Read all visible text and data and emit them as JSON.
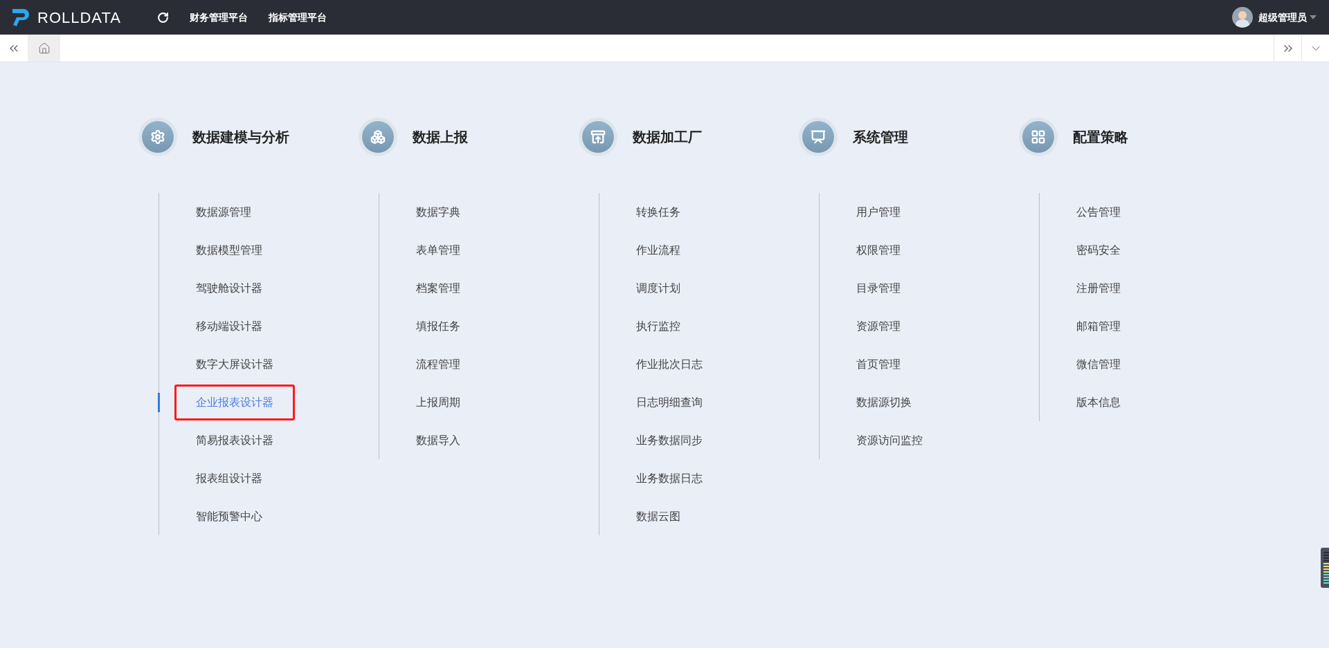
{
  "header": {
    "logo_text": "ROLLDATA",
    "nav": [
      "财务管理平台",
      "指标管理平台"
    ],
    "user": {
      "name": "超级管理员"
    }
  },
  "categories": [
    {
      "title": "数据建模与分析",
      "items": [
        {
          "label": "数据源管理",
          "selected": false,
          "annotated": false
        },
        {
          "label": "数据模型管理",
          "selected": false,
          "annotated": false
        },
        {
          "label": "驾驶舱设计器",
          "selected": false,
          "annotated": false
        },
        {
          "label": "移动端设计器",
          "selected": false,
          "annotated": false
        },
        {
          "label": "数字大屏设计器",
          "selected": false,
          "annotated": false
        },
        {
          "label": "企业报表设计器",
          "selected": true,
          "annotated": true
        },
        {
          "label": "简易报表设计器",
          "selected": false,
          "annotated": false
        },
        {
          "label": "报表组设计器",
          "selected": false,
          "annotated": false
        },
        {
          "label": "智能预警中心",
          "selected": false,
          "annotated": false
        }
      ]
    },
    {
      "title": "数据上报",
      "items": [
        {
          "label": "数据字典",
          "selected": false,
          "annotated": false
        },
        {
          "label": "表单管理",
          "selected": false,
          "annotated": false
        },
        {
          "label": "档案管理",
          "selected": false,
          "annotated": false
        },
        {
          "label": "填报任务",
          "selected": false,
          "annotated": false
        },
        {
          "label": "流程管理",
          "selected": false,
          "annotated": false
        },
        {
          "label": "上报周期",
          "selected": false,
          "annotated": false
        },
        {
          "label": "数据导入",
          "selected": false,
          "annotated": false
        }
      ]
    },
    {
      "title": "数据加工厂",
      "items": [
        {
          "label": "转换任务",
          "selected": false,
          "annotated": false
        },
        {
          "label": "作业流程",
          "selected": false,
          "annotated": false
        },
        {
          "label": "调度计划",
          "selected": false,
          "annotated": false
        },
        {
          "label": "执行监控",
          "selected": false,
          "annotated": false
        },
        {
          "label": "作业批次日志",
          "selected": false,
          "annotated": false
        },
        {
          "label": "日志明细查询",
          "selected": false,
          "annotated": false
        },
        {
          "label": "业务数据同步",
          "selected": false,
          "annotated": false
        },
        {
          "label": "业务数据日志",
          "selected": false,
          "annotated": false
        },
        {
          "label": "数据云图",
          "selected": false,
          "annotated": false
        }
      ]
    },
    {
      "title": "系统管理",
      "items": [
        {
          "label": "用户管理",
          "selected": false,
          "annotated": false
        },
        {
          "label": "权限管理",
          "selected": false,
          "annotated": false
        },
        {
          "label": "目录管理",
          "selected": false,
          "annotated": false
        },
        {
          "label": "资源管理",
          "selected": false,
          "annotated": false
        },
        {
          "label": "首页管理",
          "selected": false,
          "annotated": false
        },
        {
          "label": "数据源切换",
          "selected": false,
          "annotated": false
        },
        {
          "label": "资源访问监控",
          "selected": false,
          "annotated": false
        }
      ]
    },
    {
      "title": "配置策略",
      "items": [
        {
          "label": "公告管理",
          "selected": false,
          "annotated": false
        },
        {
          "label": "密码安全",
          "selected": false,
          "annotated": false
        },
        {
          "label": "注册管理",
          "selected": false,
          "annotated": false
        },
        {
          "label": "邮箱管理",
          "selected": false,
          "annotated": false
        },
        {
          "label": "微信管理",
          "selected": false,
          "annotated": false
        },
        {
          "label": "版本信息",
          "selected": false,
          "annotated": false
        }
      ]
    }
  ]
}
